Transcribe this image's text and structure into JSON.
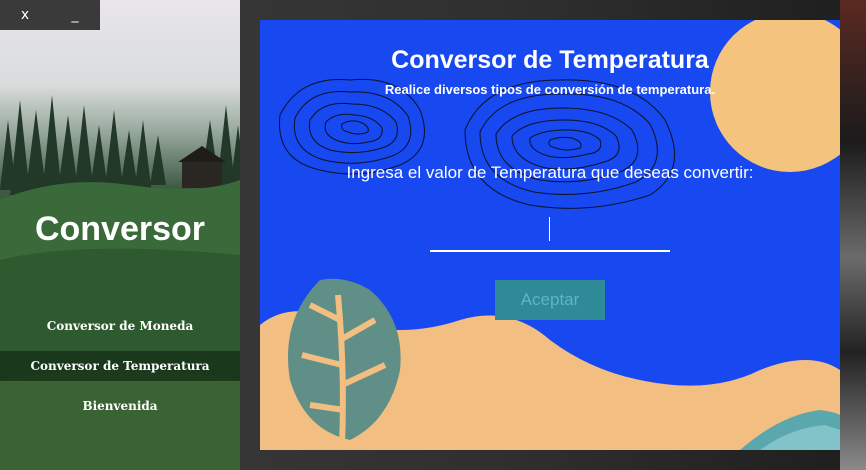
{
  "window_controls": {
    "close_label": "x",
    "minimize_label": "_"
  },
  "sidebar": {
    "app_title": "Conversor",
    "items": [
      {
        "label": "Conversor de Moneda",
        "active": false
      },
      {
        "label": "Conversor de Temperatura",
        "active": true
      },
      {
        "label": "Bienvenida",
        "active": false
      }
    ]
  },
  "main": {
    "title": "Conversor de Temperatura",
    "subtitle": "Realice diversos tipos de conversión de temperatura.",
    "prompt": "Ingresa el valor de Temperatura que deseas convertir:",
    "input_value": "",
    "accept_label": "Aceptar"
  },
  "colors": {
    "panel_blue": "#1748f0",
    "sand": "#f2be82",
    "sun": "#f4c37d",
    "leaf": "#5f8f86",
    "button": "#2e8a96"
  }
}
